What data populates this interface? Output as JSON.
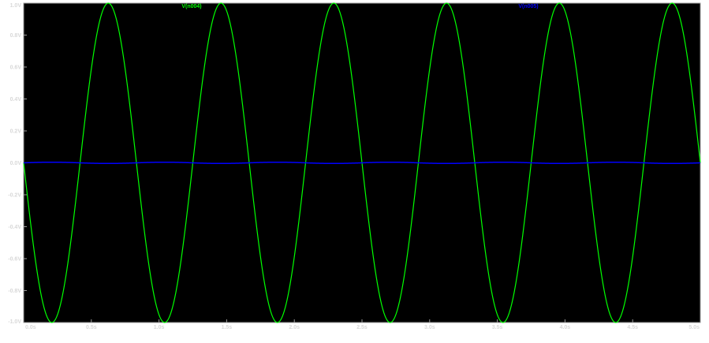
{
  "chart_data": {
    "type": "line",
    "xlim": [
      0,
      5
    ],
    "ylim": [
      -1,
      1
    ],
    "x_ticks": [
      0,
      0.5,
      1,
      1.5,
      2,
      2.5,
      3,
      3.5,
      4,
      4.5,
      5
    ],
    "x_tick_labels": [
      "0.0s",
      "0.5s",
      "1.0s",
      "1.5s",
      "2.0s",
      "2.5s",
      "3.0s",
      "3.5s",
      "4.0s",
      "4.5s",
      "5.0s"
    ],
    "y_ticks": [
      1,
      0.8,
      0.6,
      0.4,
      0.2,
      0,
      -0.2,
      -0.4,
      -0.6,
      -0.8,
      -1
    ],
    "y_tick_labels": [
      "1.0V",
      "0.8V",
      "0.6V",
      "0.4V",
      "0.2V",
      "0.0V",
      "-0.2V",
      "-0.4V",
      "-0.6V",
      "-0.8V",
      "-1.0V"
    ],
    "grid": false,
    "background": "#000000",
    "series": [
      {
        "name": "V(n004)",
        "color": "#00ff00",
        "waveform": "sine",
        "amplitude": 1,
        "frequency_hz": 1.2,
        "phase_deg": 180,
        "offset": 0,
        "x": [
          0,
          0.208,
          0.417,
          0.625,
          0.833,
          1.042,
          1.25,
          1.458,
          1.667,
          1.875,
          2.083,
          2.292,
          2.5,
          2.708,
          2.917,
          3.125,
          3.333,
          3.542,
          3.75,
          3.958,
          4.167,
          4.375,
          4.583,
          4.792,
          5.0
        ],
        "y": [
          0,
          -1,
          0,
          1,
          0,
          -1,
          0,
          1,
          0,
          -1,
          0,
          1,
          0,
          -1,
          0,
          1,
          0,
          -1,
          0,
          1,
          0,
          -1,
          0,
          1,
          0
        ]
      },
      {
        "name": "V(n005)",
        "color": "#0000ff",
        "waveform": "sine",
        "amplitude": 0.004,
        "frequency_hz": 1.2,
        "phase_deg": 0,
        "offset": 0,
        "x": [
          0,
          5
        ],
        "y": [
          0,
          0
        ]
      }
    ]
  }
}
